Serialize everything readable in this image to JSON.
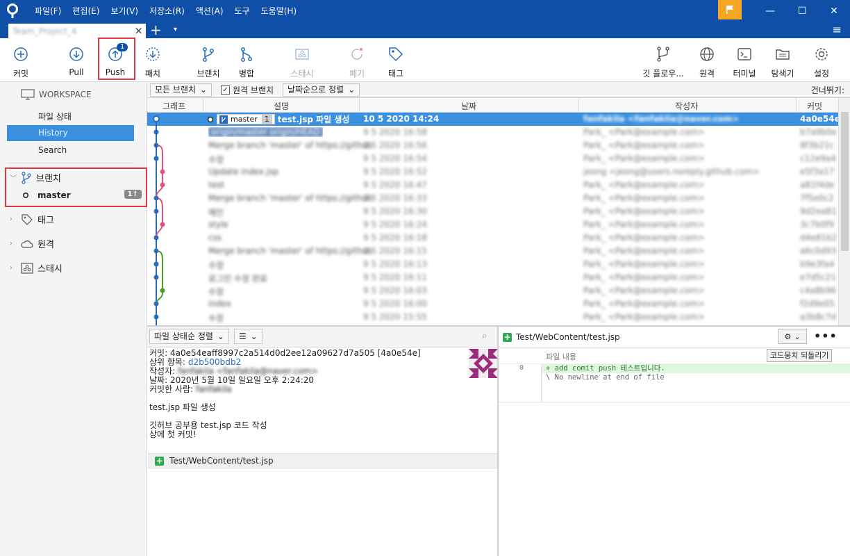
{
  "title_bar": {
    "menu": [
      "파일(F)",
      "편집(E)",
      "보기(V)",
      "저장소(R)",
      "액션(A)",
      "도구",
      "도움말(H)"
    ],
    "accent": "#0f4fa8",
    "flag_color": "#f5a623"
  },
  "tab": {
    "title": "Team_Project_4",
    "close": "×",
    "add": "+",
    "dropdown": "▾",
    "menu_icon": "≡"
  },
  "toolbar": {
    "commit": "커밋",
    "pull": "Pull",
    "push": "Push",
    "push_badge": "1",
    "patch": "패치",
    "branch": "브랜치",
    "merge": "병합",
    "stash": "스태시",
    "discard": "폐기",
    "tag": "태그",
    "gitflow": "깃 플로우...",
    "remote": "원격",
    "terminal": "터미널",
    "explorer": "탐색기",
    "settings": "설정"
  },
  "sidebar": {
    "workspace": "WORKSPACE",
    "file_status": "파일 상태",
    "history": "History",
    "search": "Search",
    "branches": "브랜치",
    "master": "master",
    "master_badge": "1↑",
    "tags": "태그",
    "remotes": "원격",
    "stashes": "스태시"
  },
  "filter_bar": {
    "all_branches": "모든 브랜치",
    "remote_branches": "원격 브랜치",
    "sort": "날짜순으로 정렬",
    "skip": "건너뛰기:"
  },
  "columns": {
    "graph": "그래프",
    "description": "설명",
    "date": "날짜",
    "author": "작성자",
    "commit": "커밋"
  },
  "selected_commit": {
    "branch": "master",
    "ahead": "1",
    "description": "test.jsp 파일 생성",
    "date": "10 5 2020 14:24",
    "author": "fanfakila <fanfakila@naver.com>",
    "hash": "4a0e54e"
  },
  "history_rows": [
    {
      "desc": "origin/master  origin/HEAD",
      "date": "9 5 2020 16:58",
      "author": "Park_ <Park@example.com>",
      "hash": "b7a9b0e"
    },
    {
      "desc": "Merge branch 'master' of https://github",
      "date": "9 5 2020 16:56",
      "author": "Park_ <Park@example.com>",
      "hash": "8f3b21c"
    },
    {
      "desc": "수정",
      "date": "9 5 2020 16:54",
      "author": "Park_ <Park@example.com>",
      "hash": "c12e9a4"
    },
    {
      "desc": "Update index.jsp",
      "date": "9 5 2020 16:52",
      "author": "jeong <jeong@users.noreply.github.com>",
      "hash": "e5f3a17"
    },
    {
      "desc": "test",
      "date": "9 5 2020 16:47",
      "author": "Park_ <Park@example.com>",
      "hash": "a81f4de"
    },
    {
      "desc": "Merge branch 'master' of https://github",
      "date": "9 5 2020 16:33",
      "author": "Park_ <Park@example.com>",
      "hash": "7f5e0c2"
    },
    {
      "desc": "메인",
      "date": "9 5 2020 16:30",
      "author": "Park_ <Park@example.com>",
      "hash": "9d2ea81"
    },
    {
      "desc": "style",
      "date": "9 5 2020 16:24",
      "author": "Park_ <Park@example.com>",
      "hash": "3c7b0f9"
    },
    {
      "desc": "css",
      "date": "9 5 2020 16:18",
      "author": "Park_ <Park@example.com>",
      "hash": "d4e81b2"
    },
    {
      "desc": "Merge branch 'master' of https://github",
      "date": "9 5 2020 16:15",
      "author": "Park_ <Park@example.com>",
      "hash": "a6c0d93"
    },
    {
      "desc": "수정",
      "date": "9 5 2020 16:13",
      "author": "Park_ <Park@example.com>",
      "hash": "b9e3fa4"
    },
    {
      "desc": "로그인 수정 완료",
      "date": "9 5 2020 16:11",
      "author": "Park_ <Park@example.com>",
      "hash": "e7d5c21"
    },
    {
      "desc": "수정",
      "date": "9 5 2020 16:03",
      "author": "Park_ <Park@example.com>",
      "hash": "c4a8b96"
    },
    {
      "desc": "index",
      "date": "9 5 2020 16:00",
      "author": "Park_ <Park@example.com>",
      "hash": "f2d9e05"
    },
    {
      "desc": "수정",
      "date": "9 5 2020 15:55",
      "author": "Park_ <Park@example.com>",
      "hash": "a3b8c7d"
    }
  ],
  "detail": {
    "sort_label": "파일 상태순 정렬",
    "view_icon": "☰",
    "commit_label": "커밋:",
    "commit_full": "4a0e54eaff8997c2a514d0d2ee12a09627d7a505 [4a0e54e]",
    "parent_label": "상위 항목:",
    "parent": "d2b500bdb2",
    "author_label": "작성자:",
    "author": "fanfakila <fanfakila@naver.com>",
    "date_label": "날짜:",
    "date": "2020년 5월 10일 일요일 오후 2:24:20",
    "committer_label": "커밋한 사람:",
    "committer": "fanfakila",
    "message_line1": "test.jsp 파일 생성",
    "message_line2": "깃허브 공부용 test.jsp 코드 작성",
    "message_line3": "상에 첫 커밋!",
    "file": "Test/WebContent/test.jsp"
  },
  "diff": {
    "file": "Test/WebContent/test.jsp",
    "hunk_label": "파일 내용",
    "revert": "코드뭉치 되돌리기",
    "line_no": "0",
    "added": "+ add comit push 테스트입니다.",
    "no_newline": "\\  No newline at end of file",
    "more": "•••"
  }
}
